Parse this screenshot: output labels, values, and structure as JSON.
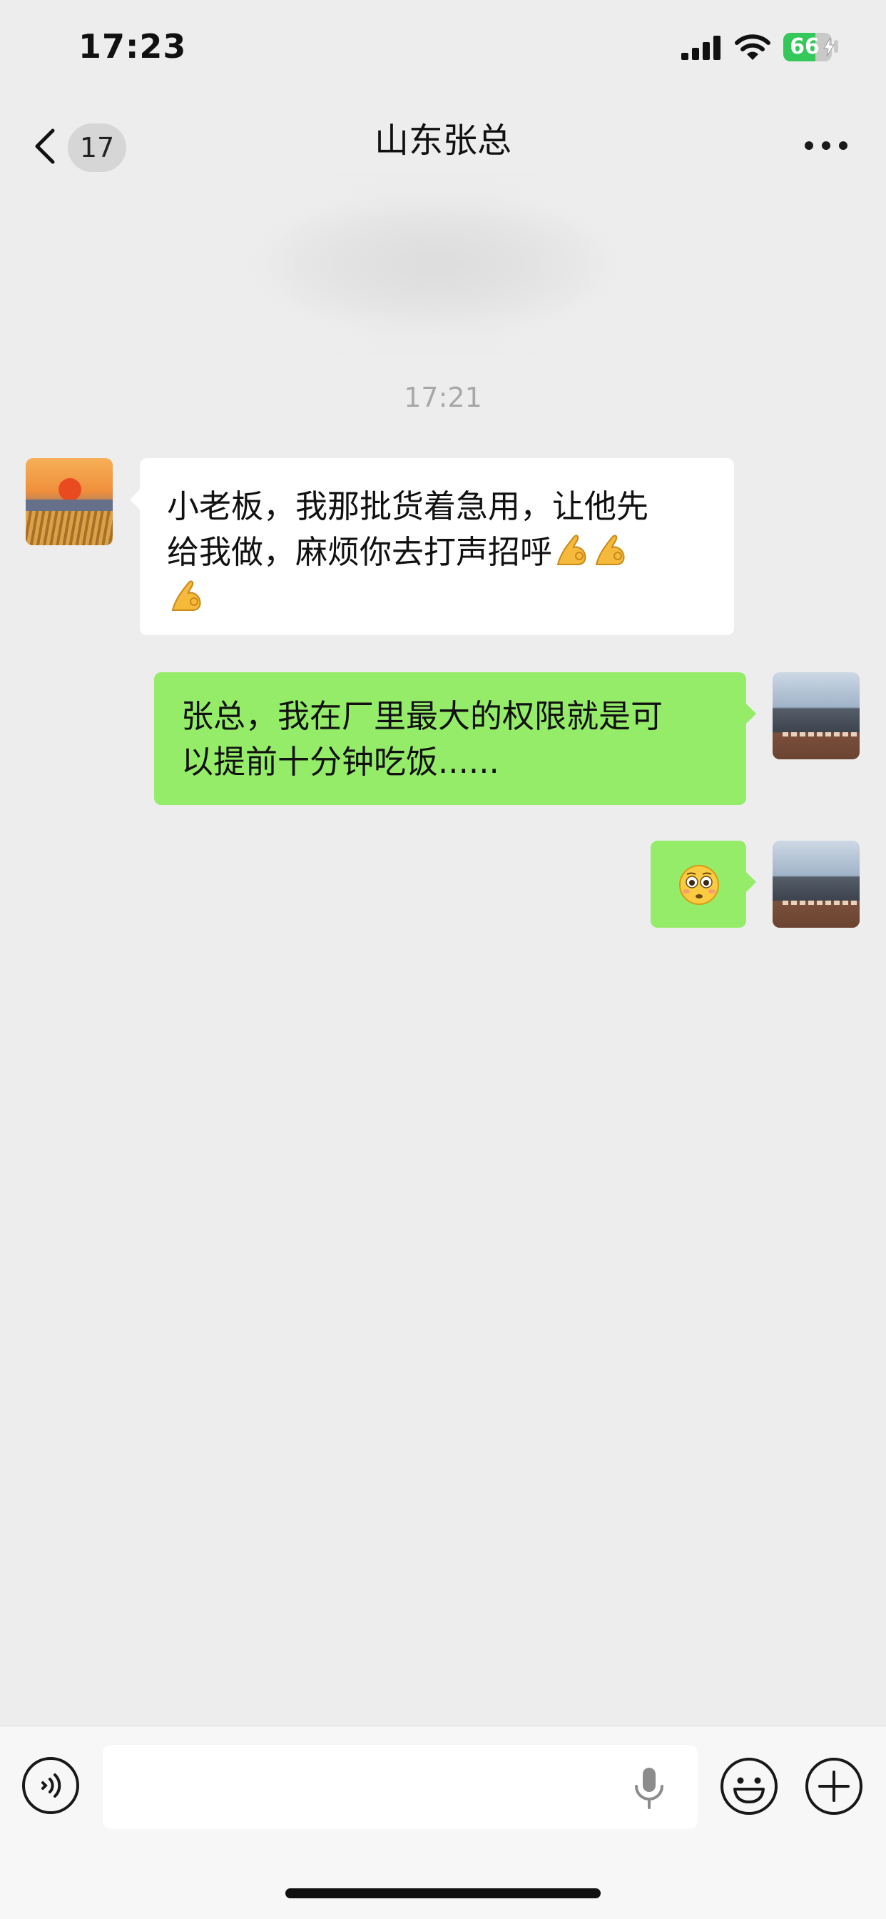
{
  "status_bar": {
    "time": "17:23",
    "battery_level": "66",
    "battery_fraction": 0.66,
    "charging": true,
    "icons": [
      "signal-icon",
      "wifi-icon",
      "battery-icon",
      "charging-bolt-icon"
    ]
  },
  "nav": {
    "unread_count": "17",
    "title": "山东张总",
    "icons": [
      "back-chevron-icon",
      "more-dots-icon"
    ]
  },
  "chat": {
    "timestamp": "17:21",
    "messages": [
      {
        "side": "incoming",
        "line1": "小老板，我那批货着急用，让他先",
        "line2": "给我做，麻烦你去打声招呼",
        "emoji": "ok-hand-emoji",
        "emoji_count": 3
      },
      {
        "side": "outgoing",
        "line1": "张总，我在厂里最大的权限就是可",
        "line2": "以提前十分钟吃饭......"
      },
      {
        "side": "outgoing",
        "emoji": "flushed-face-emoji"
      }
    ]
  },
  "input_bar": {
    "value": "",
    "icons": [
      "voice-mode-icon",
      "microphone-icon",
      "emoji-icon",
      "plus-icon"
    ]
  },
  "colors": {
    "background": "#ededed",
    "incoming_bubble": "#ffffff",
    "outgoing_bubble": "#95ec69",
    "timestamp": "#a8a8a8",
    "battery_green": "#34c759"
  }
}
